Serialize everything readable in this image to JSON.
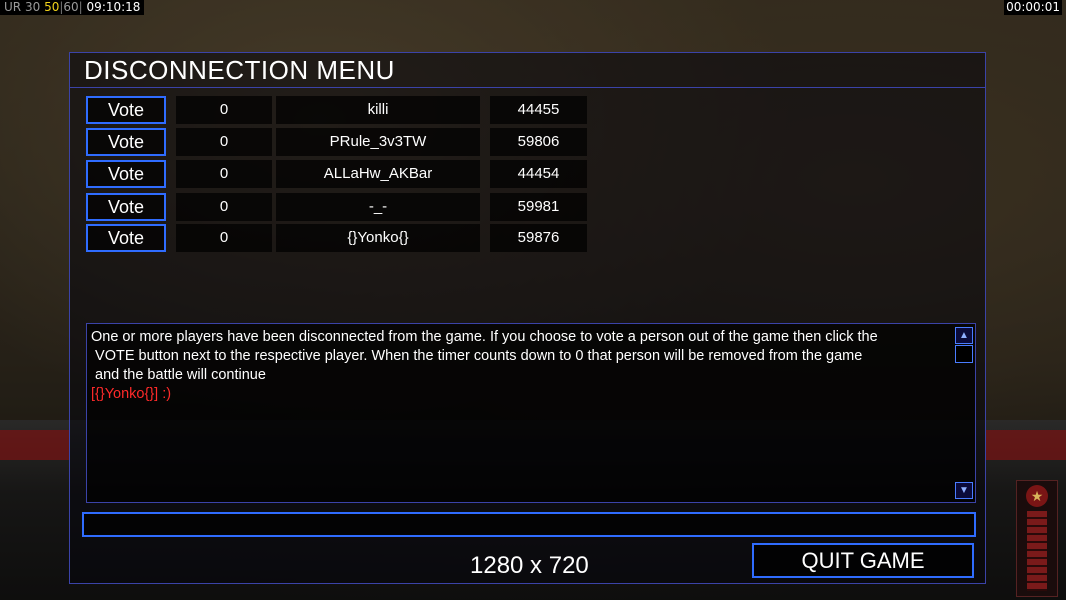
{
  "overlay": {
    "fps_prefix": "UR",
    "fps_a": "30",
    "fps_b": "50",
    "fps_c": "60",
    "clock": "09:10:18",
    "game_timer": "00:00:01"
  },
  "dialog": {
    "title": "DISCONNECTION MENU",
    "vote_label": "Vote",
    "players": [
      {
        "votes": "0",
        "name": "killi",
        "id": "44455"
      },
      {
        "votes": "0",
        "name": "PRule_3v3TW",
        "id": "59806"
      },
      {
        "votes": "0",
        "name": "ALLaHw_AKBar",
        "id": "44454"
      },
      {
        "votes": "0",
        "name": "-_-",
        "id": "59981"
      },
      {
        "votes": "0",
        "name": "{}Yonko{}",
        "id": "59876"
      }
    ],
    "message": {
      "line1": "One or more players have been disconnected from the game. If you choose to vote a person out of the game then click the",
      "line2": " VOTE button next to the respective player. When the timer counts down to 0 that person will be removed from the game",
      "line3": " and the battle will continue",
      "chat": "[{}Yonko{}] :)"
    },
    "chat_input_value": "",
    "quit_label": "QUIT GAME",
    "resolution": "1280 x 720"
  },
  "colors": {
    "accent_blue": "#2f6cff",
    "border_blue": "#3b43a8",
    "chat_red": "#ff2a2a",
    "fps_yellow": "#f0d21a"
  }
}
